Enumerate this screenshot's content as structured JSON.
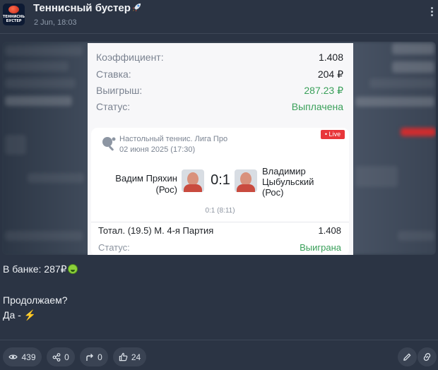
{
  "header": {
    "channel_title": "Теннисный бустер",
    "title_emoji_icon": "rocket-icon",
    "timestamp": "2 Jun, 18:03",
    "avatar_text_line1": "ТЕННИСНЫЙ",
    "avatar_text_line2": "БУСТЕР"
  },
  "receipt": {
    "rows": [
      {
        "label": "Коэффициент:",
        "value": "1.408"
      },
      {
        "label": "Ставка:",
        "value": "204 ₽"
      },
      {
        "label": "Выигрыш:",
        "value": "287.23 ₽"
      },
      {
        "label": "Статус:",
        "value": "Выплачена"
      }
    ],
    "match": {
      "league": "Настольный теннис. Лига Про",
      "date": "02 июня 2025 (17:30)",
      "live_badge": "• Live",
      "player_a_line1": "Вадим Пряхин",
      "player_a_line2": "(Рос)",
      "player_b_line1": "Владимир",
      "player_b_line2": "Цыбульский",
      "player_b_line3": "(Рос)",
      "score": "0:1",
      "subscore": "0:1 (8:11)",
      "market": "Тотал. (19.5) М. 4-я Партия",
      "market_odds": "1.408",
      "bet_status_label": "Статус:",
      "bet_status_value": "Выиграна"
    }
  },
  "message": {
    "line1": "В банке: 287₽",
    "line1_emoji": "money-face-icon",
    "line2": "Продолжаем?",
    "line3": "Да - ",
    "line3_emoji": "lightning-icon"
  },
  "footer": {
    "views": "439",
    "shares": "0",
    "forwards": "0",
    "likes": "24"
  },
  "colors": {
    "background": "#2b3444",
    "card": "#f7f7f9",
    "green": "#3aa05a",
    "live_red": "#e8363a"
  }
}
